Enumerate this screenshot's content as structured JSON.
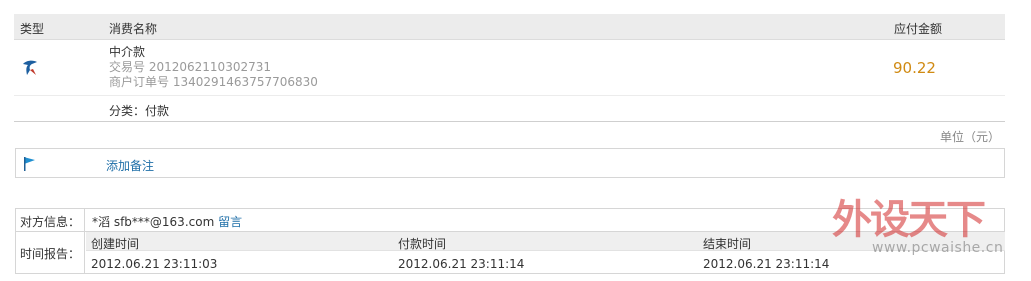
{
  "order_table": {
    "headers": {
      "type": "类型",
      "name": "消费名称",
      "amount": "应付金额"
    },
    "item": {
      "icon": "bird-logo-icon",
      "title": "中介款",
      "trade_no_label": "交易号",
      "trade_no": "2012062110302731",
      "merchant_no_label": "商户订单号",
      "merchant_no": "1340291463757706830",
      "amount": "90.22"
    },
    "category": "分类：付款"
  },
  "unit": "单位（元）",
  "note": {
    "icon": "flag-icon",
    "label": "添加备注"
  },
  "info": {
    "counterparty_label": "对方信息：",
    "counterparty": "*滔 sfb***@163.com",
    "message_link": "留言",
    "time_label": "时间报告：",
    "time_headers": [
      "创建时间",
      "付款时间",
      "结束时间"
    ],
    "times": [
      "2012.06.21 23:11:03",
      "2012.06.21 23:11:14",
      "2012.06.21 23:11:14"
    ]
  },
  "watermark": {
    "brand": "外设天下",
    "url": "www.pcwaishe.cn"
  },
  "colors": {
    "amount": "#d08a12",
    "link": "#1f6fa8",
    "header_bg": "#ececec"
  }
}
